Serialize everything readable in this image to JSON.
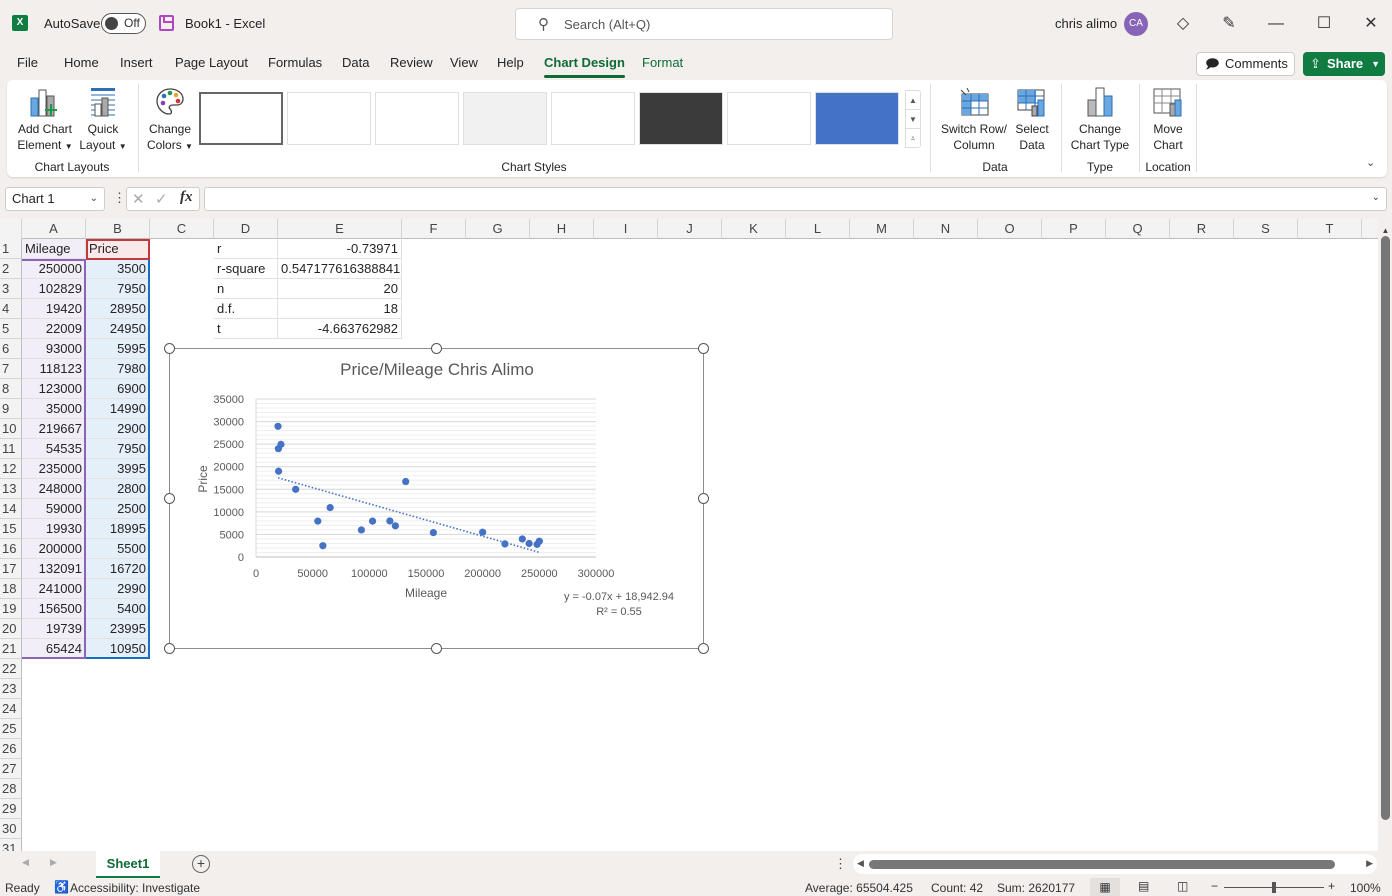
{
  "app": {
    "autosave_label": "AutoSave",
    "autosave_state": "Off",
    "doc_title": "Book1  -  Excel",
    "search_placeholder": "Search (Alt+Q)",
    "user_name": "chris alimo",
    "user_initials": "CA"
  },
  "menu": {
    "tabs": [
      "File",
      "Home",
      "Insert",
      "Page Layout",
      "Formulas",
      "Data",
      "Review",
      "View",
      "Help",
      "Chart Design",
      "Format"
    ],
    "active_tab": "Chart Design",
    "comments_label": "Comments",
    "share_label": "Share"
  },
  "ribbon": {
    "add_chart_element": [
      "Add Chart",
      "Element"
    ],
    "quick_layout": [
      "Quick",
      "Layout"
    ],
    "change_colors": [
      "Change",
      "Colors"
    ],
    "switch_row_col": [
      "Switch Row/",
      "Column"
    ],
    "select_data": [
      "Select",
      "Data"
    ],
    "change_chart_type": [
      "Change",
      "Chart Type"
    ],
    "move_chart": [
      "Move",
      "Chart"
    ],
    "groups": {
      "chart_layouts": "Chart Layouts",
      "chart_styles": "Chart Styles",
      "data": "Data",
      "type": "Type",
      "location": "Location"
    },
    "style_count": 8,
    "selected_style": 1
  },
  "formula_bar": {
    "name_box": "Chart 1",
    "formula": ""
  },
  "columns": [
    "A",
    "B",
    "C",
    "D",
    "E",
    "F",
    "G",
    "H",
    "I",
    "J",
    "K",
    "L",
    "M",
    "N",
    "O",
    "P",
    "Q",
    "R",
    "S",
    "T"
  ],
  "rows_visible": 31,
  "sheet": {
    "A1": "Mileage",
    "B1": "Price",
    "mileage": [
      250000,
      102829,
      19420,
      22009,
      93000,
      118123,
      123000,
      35000,
      219667,
      54535,
      235000,
      248000,
      59000,
      19930,
      200000,
      132091,
      241000,
      156500,
      19739,
      65424
    ],
    "price": [
      3500,
      7950,
      28950,
      24950,
      5995,
      7980,
      6900,
      14990,
      2900,
      7950,
      3995,
      2800,
      2500,
      18995,
      5500,
      16720,
      2990,
      5400,
      23995,
      10950
    ],
    "stats": [
      {
        "label": "r",
        "value": "-0.73971"
      },
      {
        "label": "r-square",
        "value": "0.547177616388841"
      },
      {
        "label": "n",
        "value": "20"
      },
      {
        "label": "d.f.",
        "value": "18"
      },
      {
        "label": "t",
        "value": "-4.663762982"
      }
    ]
  },
  "chart_data": {
    "type": "scatter",
    "title": "Price/Mileage Chris Alimo",
    "xlabel": "Mileage",
    "ylabel": "Price",
    "xlim": [
      0,
      300000
    ],
    "ylim": [
      0,
      35000
    ],
    "xticks": [
      0,
      50000,
      100000,
      150000,
      200000,
      250000,
      300000
    ],
    "yticks": [
      0,
      5000,
      10000,
      15000,
      20000,
      25000,
      30000,
      35000
    ],
    "grid": true,
    "minor_grid": true,
    "series": [
      {
        "name": "Price",
        "x": [
          250000,
          102829,
          19420,
          22009,
          93000,
          118123,
          123000,
          35000,
          219667,
          54535,
          235000,
          248000,
          59000,
          19930,
          200000,
          132091,
          241000,
          156500,
          19739,
          65424
        ],
        "y": [
          3500,
          7950,
          28950,
          24950,
          5995,
          7980,
          6900,
          14990,
          2900,
          7950,
          3995,
          2800,
          2500,
          18995,
          5500,
          16720,
          2990,
          5400,
          23995,
          10950
        ],
        "color": "#4472c4"
      }
    ],
    "trendline": {
      "type": "linear",
      "slope": -0.07,
      "intercept": 18942.94,
      "x_range": [
        19420,
        250000
      ],
      "equation": "y = -0.07x + 18,942.94",
      "r_squared": "R² = 0.55"
    }
  },
  "sheet_tabs": [
    "Sheet1"
  ],
  "status": {
    "ready": "Ready",
    "accessibility": "Accessibility: Investigate",
    "average": "Average: 65504.425",
    "count": "Count: 42",
    "sum": "Sum: 2620177",
    "zoom": "100%"
  },
  "colors": {
    "excel_green": "#107c41",
    "active_tab": "#0e6b36",
    "marker": "#4472c4",
    "avatar": "#8764b8"
  }
}
